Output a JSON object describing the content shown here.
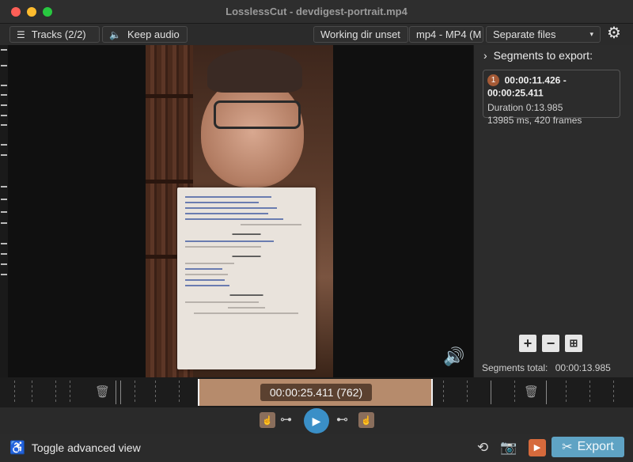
{
  "window": {
    "title": "LosslessCut - devdigest-portrait.mp4"
  },
  "toolbar": {
    "tracks_label": "Tracks (2/2)",
    "audio_label": "Keep audio",
    "workdir_label": "Working dir unset",
    "format_label": "mp4 - MP4 (M",
    "output_mode_label": "Separate files",
    "icons": {
      "tracks": "list-icon",
      "audio": "speaker-icon",
      "settings": "gear-icon"
    }
  },
  "sidebar": {
    "heading": "Segments to export:",
    "segments": [
      {
        "number": "1",
        "range": "00:00:11.426 - 00:00:25.411",
        "duration": "Duration 0:13.985",
        "info": "13985 ms, 420 frames",
        "color": "#a55a36"
      }
    ],
    "total_label": "Segments total:",
    "total_value": "00:00:13.985"
  },
  "timeline": {
    "current_time": "00:00:25.411 (762)",
    "segment_color": "#b68b6c"
  },
  "controls": {
    "play_icon": "play-icon",
    "accent_color": "#3a8fc7"
  },
  "bottom": {
    "advanced_view_label": "Toggle advanced view",
    "export_label": "Export",
    "export_color": "#5fa3c4"
  }
}
